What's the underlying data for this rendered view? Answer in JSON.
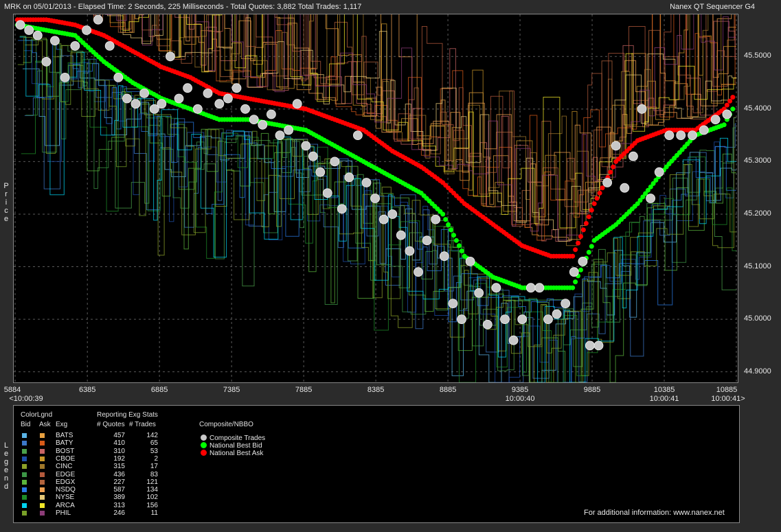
{
  "window": {
    "title_left": "MRK on 05/01/2013  -  Elapsed Time: 2 Seconds, 225 Milliseconds  -  Total Quotes: 3,882  Total Trades: 1,117",
    "title_right": "Nanex QT Sequencer G4"
  },
  "colors": {
    "background": "#000000",
    "grid": "#5a5a5a",
    "trade": "#c8c8c8",
    "best_bid": "#00ff00",
    "best_ask": "#ff0000"
  },
  "chart_data": {
    "type": "scatter",
    "ylabel": "Price",
    "xlim": [
      5884,
      10885
    ],
    "ylim": [
      44.88,
      45.58
    ],
    "y_ticks": [
      "45.5000",
      "45.4000",
      "45.3000",
      "45.2000",
      "45.1000",
      "45.0000",
      "44.9000"
    ],
    "x_ticks": [
      "5884",
      "6385",
      "6885",
      "7385",
      "7885",
      "8385",
      "8885",
      "9385",
      "9885",
      "10385",
      "10885"
    ],
    "x_time_labels": [
      {
        "x": 5884,
        "label": "<10:00:39"
      },
      {
        "x": 9385,
        "label": "10:00:40"
      },
      {
        "x": 10385,
        "label": "10:00:41"
      },
      {
        "x": 10885,
        "label": "10:00:41>"
      }
    ],
    "series": [
      {
        "name": "National Best Ask",
        "color": "#ff0000",
        "points": [
          [
            5900,
            45.57
          ],
          [
            6100,
            45.57
          ],
          [
            6300,
            45.56
          ],
          [
            6500,
            45.54
          ],
          [
            6700,
            45.51
          ],
          [
            6900,
            45.48
          ],
          [
            7100,
            45.46
          ],
          [
            7300,
            45.43
          ],
          [
            7500,
            45.42
          ],
          [
            7700,
            45.41
          ],
          [
            7900,
            45.4
          ],
          [
            8100,
            45.38
          ],
          [
            8300,
            45.36
          ],
          [
            8500,
            45.32
          ],
          [
            8700,
            45.29
          ],
          [
            8850,
            45.26
          ],
          [
            9000,
            45.22
          ],
          [
            9200,
            45.18
          ],
          [
            9400,
            45.14
          ],
          [
            9600,
            45.12
          ],
          [
            9750,
            45.12
          ],
          [
            9900,
            45.22
          ],
          [
            10050,
            45.3
          ],
          [
            10200,
            45.34
          ],
          [
            10400,
            45.36
          ],
          [
            10600,
            45.36
          ],
          [
            10800,
            45.4
          ],
          [
            10880,
            45.43
          ]
        ]
      },
      {
        "name": "National Best Bid",
        "color": "#00ff00",
        "points": [
          [
            5900,
            45.56
          ],
          [
            6100,
            45.55
          ],
          [
            6300,
            45.54
          ],
          [
            6500,
            45.49
          ],
          [
            6700,
            45.45
          ],
          [
            6900,
            45.42
          ],
          [
            7100,
            45.4
          ],
          [
            7300,
            45.38
          ],
          [
            7500,
            45.38
          ],
          [
            7700,
            45.37
          ],
          [
            7900,
            45.36
          ],
          [
            8100,
            45.33
          ],
          [
            8300,
            45.3
          ],
          [
            8500,
            45.27
          ],
          [
            8700,
            45.24
          ],
          [
            8850,
            45.2
          ],
          [
            9000,
            45.12
          ],
          [
            9200,
            45.08
          ],
          [
            9400,
            45.06
          ],
          [
            9600,
            45.06
          ],
          [
            9750,
            45.06
          ],
          [
            9900,
            45.15
          ],
          [
            10050,
            45.18
          ],
          [
            10200,
            45.22
          ],
          [
            10400,
            45.29
          ],
          [
            10600,
            45.35
          ],
          [
            10800,
            45.37
          ],
          [
            10880,
            45.41
          ]
        ]
      },
      {
        "name": "Composite Trades",
        "color": "#c8c8c8",
        "points": [
          [
            5920,
            45.56
          ],
          [
            5980,
            45.55
          ],
          [
            6040,
            45.54
          ],
          [
            6100,
            45.49
          ],
          [
            6160,
            45.53
          ],
          [
            6230,
            45.46
          ],
          [
            6300,
            45.52
          ],
          [
            6380,
            45.55
          ],
          [
            6460,
            45.57
          ],
          [
            6540,
            45.52
          ],
          [
            6600,
            45.46
          ],
          [
            6660,
            45.42
          ],
          [
            6720,
            45.41
          ],
          [
            6780,
            45.43
          ],
          [
            6850,
            45.4
          ],
          [
            6900,
            45.41
          ],
          [
            6960,
            45.5
          ],
          [
            7020,
            45.42
          ],
          [
            7080,
            45.44
          ],
          [
            7150,
            45.4
          ],
          [
            7220,
            45.43
          ],
          [
            7300,
            45.41
          ],
          [
            7360,
            45.42
          ],
          [
            7420,
            45.44
          ],
          [
            7480,
            45.4
          ],
          [
            7540,
            45.38
          ],
          [
            7600,
            45.37
          ],
          [
            7660,
            45.39
          ],
          [
            7720,
            45.35
          ],
          [
            7780,
            45.36
          ],
          [
            7840,
            45.41
          ],
          [
            7900,
            45.33
          ],
          [
            7950,
            45.31
          ],
          [
            8000,
            45.28
          ],
          [
            8050,
            45.24
          ],
          [
            8100,
            45.3
          ],
          [
            8150,
            45.21
          ],
          [
            8200,
            45.27
          ],
          [
            8260,
            45.35
          ],
          [
            8320,
            45.26
          ],
          [
            8380,
            45.23
          ],
          [
            8440,
            45.19
          ],
          [
            8500,
            45.2
          ],
          [
            8560,
            45.16
          ],
          [
            8620,
            45.13
          ],
          [
            8680,
            45.09
          ],
          [
            8740,
            45.15
          ],
          [
            8800,
            45.19
          ],
          [
            8860,
            45.12
          ],
          [
            8920,
            45.03
          ],
          [
            8980,
            45.0
          ],
          [
            9040,
            45.11
          ],
          [
            9100,
            45.05
          ],
          [
            9160,
            44.99
          ],
          [
            9220,
            45.06
          ],
          [
            9280,
            45.0
          ],
          [
            9340,
            44.96
          ],
          [
            9400,
            45.0
          ],
          [
            9460,
            45.06
          ],
          [
            9520,
            45.06
          ],
          [
            9580,
            45.0
          ],
          [
            9640,
            45.01
          ],
          [
            9700,
            45.03
          ],
          [
            9760,
            45.09
          ],
          [
            9820,
            45.11
          ],
          [
            9870,
            44.95
          ],
          [
            9930,
            44.95
          ],
          [
            9990,
            45.26
          ],
          [
            10050,
            45.33
          ],
          [
            10110,
            45.25
          ],
          [
            10170,
            45.31
          ],
          [
            10230,
            45.4
          ],
          [
            10290,
            45.23
          ],
          [
            10350,
            45.28
          ],
          [
            10420,
            45.35
          ],
          [
            10500,
            45.35
          ],
          [
            10580,
            45.35
          ],
          [
            10660,
            45.36
          ],
          [
            10740,
            45.38
          ],
          [
            10820,
            45.39
          ]
        ]
      }
    ]
  },
  "legend": {
    "side_label": "Legend",
    "colorlgnd_label": "ColorLgnd",
    "bid_label": "Bid",
    "ask_label": "Ask",
    "exg_label": "Exg",
    "stats_label": "Reporting Exg Stats",
    "quotes_label": "# Quotes",
    "trades_label": "# Trades",
    "composite_label": "Composite/NBBO",
    "exchanges": [
      {
        "exg": "BATS",
        "quotes": "457",
        "trades": "142",
        "bid_color": "#5ab4e6",
        "ask_color": "#e8a040"
      },
      {
        "exg": "BATY",
        "quotes": "410",
        "trades": "65",
        "bid_color": "#3c78c8",
        "ask_color": "#d85a18"
      },
      {
        "exg": "BOST",
        "quotes": "310",
        "trades": "53",
        "bid_color": "#4aa04a",
        "ask_color": "#c86464"
      },
      {
        "exg": "CBOE",
        "quotes": "192",
        "trades": "2",
        "bid_color": "#1e4ea8",
        "ask_color": "#c89628"
      },
      {
        "exg": "CINC",
        "quotes": "315",
        "trades": "17",
        "bid_color": "#8ca028",
        "ask_color": "#a0782a"
      },
      {
        "exg": "EDGE",
        "quotes": "436",
        "trades": "83",
        "bid_color": "#3c9646",
        "ask_color": "#b45a3c"
      },
      {
        "exg": "EDGX",
        "quotes": "227",
        "trades": "121",
        "bid_color": "#5ab43c",
        "ask_color": "#b4643c"
      },
      {
        "exg": "NSDQ",
        "quotes": "587",
        "trades": "134",
        "bid_color": "#287ae6",
        "ask_color": "#f0a050"
      },
      {
        "exg": "NYSE",
        "quotes": "389",
        "trades": "102",
        "bid_color": "#1e8c28",
        "ask_color": "#e6c878"
      },
      {
        "exg": "ARCA",
        "quotes": "313",
        "trades": "156",
        "bid_color": "#00d2f0",
        "ask_color": "#f0e628"
      },
      {
        "exg": "PHIL",
        "quotes": "246",
        "trades": "11",
        "bid_color": "#78a028",
        "ask_color": "#8c3c78"
      }
    ],
    "composite": [
      {
        "label": "Composite Trades",
        "color": "#c8c8c8"
      },
      {
        "label": "National Best Bid",
        "color": "#00ff00"
      },
      {
        "label": "National Best Ask",
        "color": "#ff0000"
      }
    ],
    "footer": "For additional information: www.nanex.net"
  }
}
